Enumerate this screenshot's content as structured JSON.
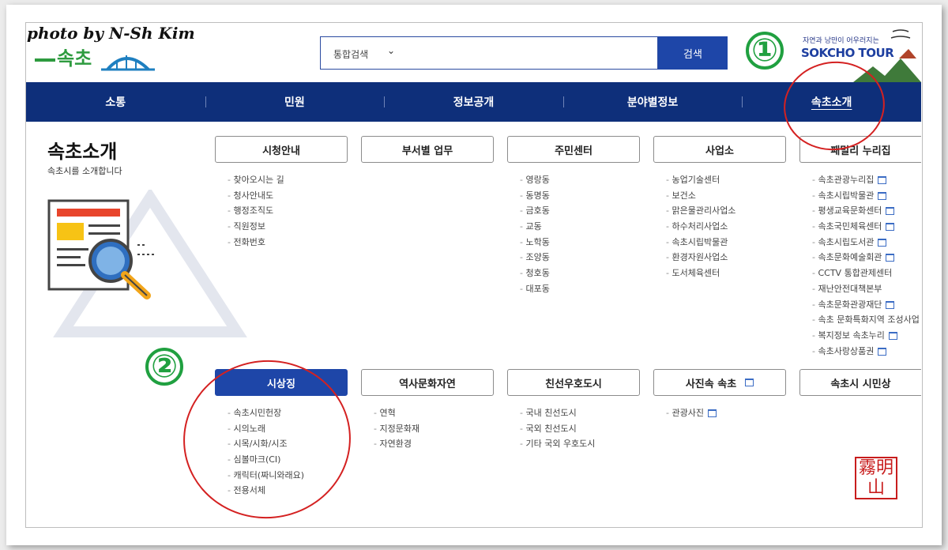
{
  "photo_credit": "photo by N-Sh Kim",
  "header": {
    "logo_text": "속초",
    "search": {
      "scope": "통합검색",
      "placeholder": "",
      "button": "검색"
    },
    "tour_logo": {
      "tagline": "자연과 낭만이 어우러지는",
      "name": "SOKCHO TOUR"
    }
  },
  "nav": [
    "소통",
    "민원",
    "정보공개",
    "분야별정보",
    "속초소개"
  ],
  "section": {
    "title": "속초소개",
    "subtitle": "속초시를 소개합니다"
  },
  "categories_row1": [
    {
      "label": "시청안내",
      "items": [
        "찾아오시는 길",
        "청사안내도",
        "행정조직도",
        "직원정보",
        "전화번호"
      ]
    },
    {
      "label": "부서별 업무",
      "items": []
    },
    {
      "label": "주민센터",
      "items": [
        "영랑동",
        "동명동",
        "금호동",
        "교동",
        "노학동",
        "조양동",
        "청호동",
        "대포동"
      ]
    },
    {
      "label": "사업소",
      "items": [
        "농업기술센터",
        "보건소",
        "맑은물관리사업소",
        "하수처리사업소",
        "속초시립박물관",
        "환경자원사업소",
        "도서체육센터"
      ]
    },
    {
      "label": "패밀리 누리집",
      "items": [
        "속초관광누리집",
        "속초시립박물관",
        "평생교육문화센터",
        "속초국민체육센터",
        "속초시립도서관",
        "속초문화예술회관",
        "CCTV 통합관제센터",
        "재난안전대책본부",
        "속초문화관광재단",
        "속초 문화특화지역 조성사업",
        "복지정보 속초누리",
        "속초사랑상품권"
      ]
    }
  ],
  "categories_row2": [
    {
      "label": "시상징",
      "items": [
        "속초시민헌장",
        "시의노래",
        "시목/시화/시조",
        "심볼마크(CI)",
        "캐릭터(짜니와래요)",
        "전용서체"
      ]
    },
    {
      "label": "역사문화자연",
      "items": [
        "연혁",
        "지정문화재",
        "자연환경"
      ]
    },
    {
      "label": "친선우호도시",
      "items": [
        "국내 친선도시",
        "국외 친선도시",
        "기타 국외 우호도시"
      ]
    },
    {
      "label": "사진속 속초",
      "items": [
        "관광사진"
      ]
    },
    {
      "label": "속초시 시민상",
      "items": []
    }
  ],
  "annotations": {
    "mark1": "①",
    "mark2": "②"
  },
  "seal_text": "霧明山",
  "colors": {
    "nav_bg": "#0e2f7a",
    "accent": "#1e46a8",
    "annotation_red": "#d42121",
    "annotation_green": "#20a040"
  },
  "icons": {
    "external_link": "new-window-icon",
    "dropdown": "chevron-down-icon",
    "illustration": "magnifier-document-icon"
  }
}
